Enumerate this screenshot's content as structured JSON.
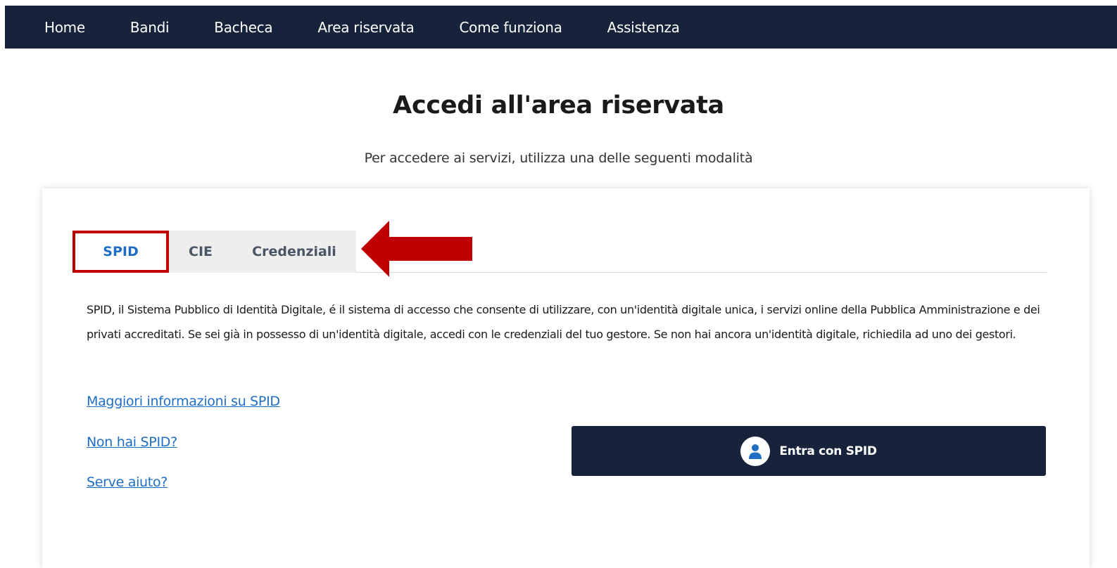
{
  "nav": {
    "items": [
      {
        "label": "Home"
      },
      {
        "label": "Bandi"
      },
      {
        "label": "Bacheca"
      },
      {
        "label": "Area riservata"
      },
      {
        "label": "Come funziona"
      },
      {
        "label": "Assistenza"
      }
    ]
  },
  "header": {
    "title": "Accedi all'area riservata",
    "subtitle": "Per accedere ai servizi, utilizza una delle seguenti modalità"
  },
  "tabs": {
    "active": "SPID",
    "items": [
      {
        "label": "SPID"
      },
      {
        "label": "CIE"
      },
      {
        "label": "Credenziali"
      }
    ]
  },
  "spid_panel": {
    "description": "SPID, il Sistema Pubblico di Identità Digitale, é il sistema di accesso che consente di utilizzare, con un'identità digitale unica, i servizi online della Pubblica Amministrazione e dei privati accreditati. Se sei già in possesso di un'identità digitale, accedi con le credenziali del tuo gestore. Se non hai ancora un'identità digitale, richiedila ad uno dei gestori.",
    "links": [
      {
        "label": "Maggiori informazioni su SPID"
      },
      {
        "label": "Non hai SPID?"
      },
      {
        "label": "Serve aiuto?"
      }
    ],
    "login_button": {
      "label": "Entra con SPID",
      "icon": "user-icon"
    }
  },
  "annotation": {
    "highlight_color": "#c00000",
    "arrow_icon": "left-arrow-icon"
  },
  "colors": {
    "nav_background": "#17233a",
    "link": "#1f6ec4",
    "button_background": "#17233a",
    "inactive_tab_background": "#eeeeee"
  }
}
